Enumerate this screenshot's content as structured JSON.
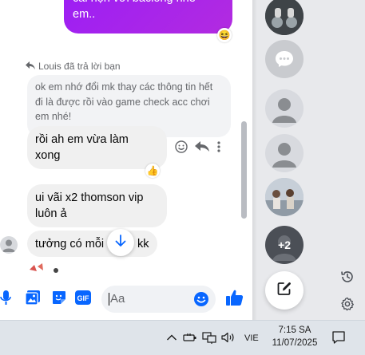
{
  "chat": {
    "own_message": {
      "line1": "cài hẹn với baclong nhé",
      "line2": "em.."
    },
    "own_reaction": "😆",
    "reply_note": "Louis đã trả lời bạn",
    "quoted_text": [
      "ok em nhớ đổi mk thay các thông tin hết",
      "đi là được rồi vào game check acc chơi",
      "em nhé!"
    ],
    "msg1": {
      "line1": "rồi ah em vừa làm",
      "line2": "xong"
    },
    "msg1_reaction": "👍",
    "msg2": {
      "line1": "ui vãi x2 thomson vip",
      "line2": "luôn ả"
    },
    "msg3": {
      "text_left": "tưởng có mỗi",
      "text_right": "kk"
    }
  },
  "composer": {
    "placeholder": "Aa"
  },
  "contacts": [
    {
      "name": "contact-photo-1"
    },
    {
      "name": "contact-chat-placeholder"
    },
    {
      "name": "contact-default-1"
    },
    {
      "name": "contact-default-2"
    },
    {
      "name": "contact-photo-2"
    },
    {
      "name": "contact-group",
      "badge": "+2"
    }
  ],
  "taskbar": {
    "language": "VIE",
    "time": "7:15 SA",
    "date": "11/07/2025"
  },
  "colors": {
    "accent": "#a11ff2",
    "messenger_blue": "#0866ff",
    "bubble_in": "#f0f0f0"
  }
}
